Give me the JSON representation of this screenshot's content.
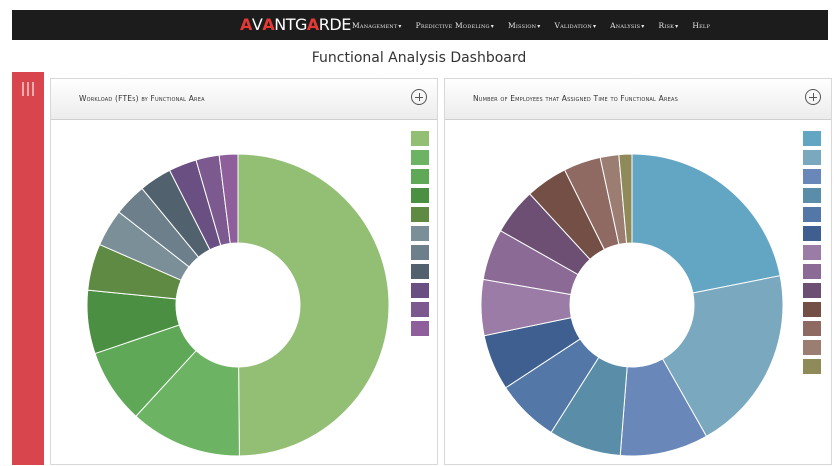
{
  "header": {
    "logo_text": "AVANTGARDE",
    "menu": [
      {
        "label": "Management",
        "caret": "▾"
      },
      {
        "label": "Predictive Modeling",
        "caret": "▾"
      },
      {
        "label": "Mission",
        "caret": "▾"
      },
      {
        "label": "Validation",
        "caret": "▾"
      },
      {
        "label": "Analysis",
        "caret": "▾"
      },
      {
        "label": "Risk",
        "caret": "▾"
      },
      {
        "label": "Help",
        "caret": ""
      }
    ]
  },
  "page": {
    "title": "Functional Analysis Dashboard"
  },
  "sidebar": {
    "icon": "hamburger-icon",
    "color": "#d9454d"
  },
  "panels": [
    {
      "title": "Workload (FTEs) by Functional Area",
      "action_icon": "plus-circle-icon"
    },
    {
      "title": "Number of Employees that Assigned Time to Functional Areas",
      "action_icon": "plus-circle-icon"
    }
  ],
  "chart_data": [
    {
      "type": "pie",
      "donut": true,
      "title": "Workload (FTEs) by Functional Area",
      "legend_position": "right",
      "legend_labels_visible": false,
      "values": [
        50,
        12,
        8,
        6.8,
        5,
        4,
        3.5,
        3.5,
        3,
        2.5,
        2
      ],
      "colors": [
        "#93bf74",
        "#6cb463",
        "#5fa858",
        "#4a8f42",
        "#5e8a43",
        "#7b8f98",
        "#6d7f8a",
        "#51626e",
        "#6a4f82",
        "#7c5a90",
        "#8e5f9a"
      ]
    },
    {
      "type": "pie",
      "donut": true,
      "title": "Number of Employees that Assigned Time to Functional Areas",
      "legend_position": "right",
      "legend_labels_visible": false,
      "values": [
        22,
        20,
        9.5,
        7.8,
        6.8,
        6,
        6,
        5.5,
        5,
        4.5,
        4,
        2,
        1.4
      ],
      "colors": [
        "#63a6c4",
        "#7aa8bf",
        "#6987b8",
        "#5a8ea8",
        "#5377a6",
        "#3e5f8f",
        "#9a7ca6",
        "#8c6a96",
        "#6d4f73",
        "#734f46",
        "#8e6a62",
        "#9c7d72",
        "#8f8a5a"
      ]
    }
  ]
}
